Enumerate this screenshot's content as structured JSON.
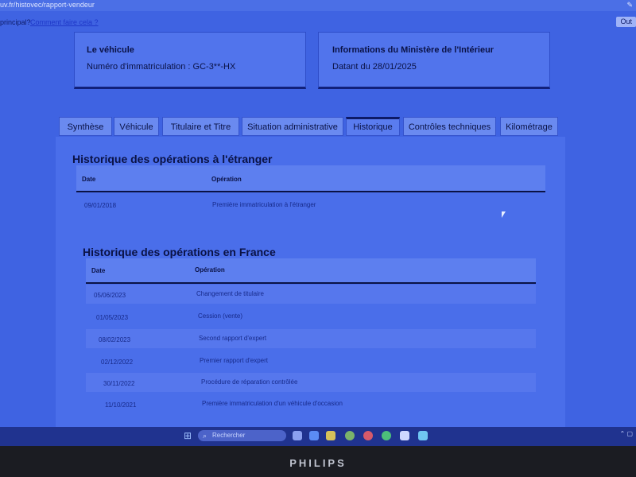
{
  "browser": {
    "url": "uv.fr/histovec/rapport-vendeur",
    "bookmark_1": "principal?",
    "bookmark_2": "Comment faire cela ?",
    "right_button": "Out"
  },
  "vehicle_card": {
    "title": "Le véhicule",
    "registration": "Numéro d'immatriculation : GC-3**-HX"
  },
  "ministry_card": {
    "title": "Informations du Ministère de l'Intérieur",
    "date": "Datant du 28/01/2025"
  },
  "tabs": [
    {
      "label": "Synthèse",
      "active": false
    },
    {
      "label": "Véhicule",
      "active": false
    },
    {
      "label": "Titulaire et Titre",
      "active": false
    },
    {
      "label": "Situation administrative",
      "active": false
    },
    {
      "label": "Historique",
      "active": true
    },
    {
      "label": "Contrôles techniques",
      "active": false
    },
    {
      "label": "Kilométrage",
      "active": false
    }
  ],
  "foreign_history": {
    "heading": "Historique des opérations à l'étranger",
    "col_date": "Date",
    "col_operation": "Opération",
    "rows": [
      {
        "date": "09/01/2018",
        "operation": "Première immatriculation à l'étranger"
      }
    ]
  },
  "france_history": {
    "heading": "Historique des opérations en France",
    "col_date": "Date",
    "col_operation": "Opération",
    "rows": [
      {
        "date": "05/06/2023",
        "operation": "Changement de titulaire"
      },
      {
        "date": "01/05/2023",
        "operation": "Cession (vente)"
      },
      {
        "date": "08/02/2023",
        "operation": "Second rapport d'expert"
      },
      {
        "date": "02/12/2022",
        "operation": "Premier rapport d'expert"
      },
      {
        "date": "30/11/2022",
        "operation": "Procédure de réparation contrôlée"
      },
      {
        "date": "11/10/2021",
        "operation": "Première immatriculation d'un véhicule d'occasion"
      }
    ]
  },
  "taskbar": {
    "search_placeholder": "Rechercher"
  },
  "monitor": {
    "brand": "PHILIPS"
  },
  "colors": {
    "screen_tint": "#3f63e2",
    "text_dark": "#0a1245"
  }
}
